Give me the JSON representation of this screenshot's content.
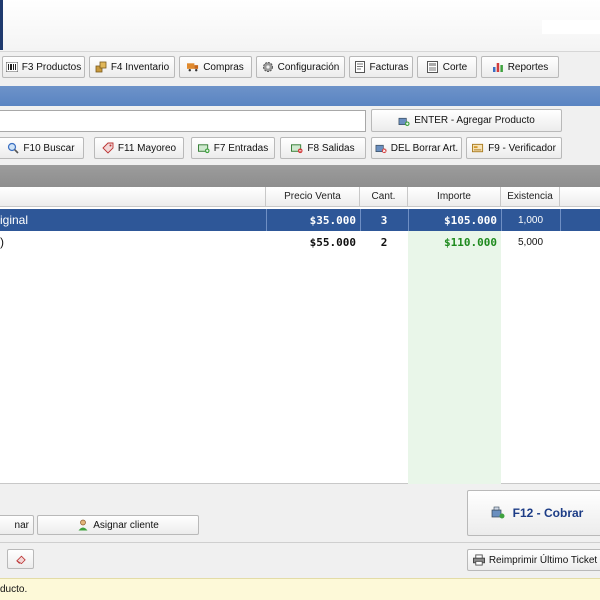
{
  "toolbar": {
    "buttons": [
      {
        "label": "F3 Productos",
        "icon": "barcode-icon"
      },
      {
        "label": "F4 Inventario",
        "icon": "boxes-icon"
      },
      {
        "label": "Compras",
        "icon": "truck-icon"
      },
      {
        "label": "Configuración",
        "icon": "gear-icon"
      },
      {
        "label": "Facturas",
        "icon": "invoice-icon"
      },
      {
        "label": "Corte",
        "icon": "register-icon"
      },
      {
        "label": "Reportes",
        "icon": "bar-chart-icon"
      }
    ]
  },
  "entry": {
    "input_value": "",
    "add_label": "ENTER - Agregar Producto"
  },
  "actions": {
    "buttons": [
      {
        "label": "F10 Buscar",
        "icon": "magnifier-icon"
      },
      {
        "label": "F11 Mayoreo",
        "icon": "tag-icon"
      },
      {
        "label": "F7 Entradas",
        "icon": "cash-in-icon"
      },
      {
        "label": "F8 Salidas",
        "icon": "cash-out-icon"
      },
      {
        "label": "DEL Borrar Art.",
        "icon": "delete-item-icon"
      },
      {
        "label": "F9 - Verificador",
        "icon": "price-check-icon"
      }
    ]
  },
  "table": {
    "headers": [
      "Precio Venta",
      "Cant.",
      "Importe",
      "Existencia"
    ],
    "rows": [
      {
        "description": "iginal",
        "price": "$35.000",
        "qty": "3",
        "amount": "$105.000",
        "stock": "1,000",
        "selected": true
      },
      {
        "description": ")",
        "price": "$55.000",
        "qty": "2",
        "amount": "$110.000",
        "stock": "5,000",
        "selected": false
      }
    ]
  },
  "bottom": {
    "partial_button_label": "nar",
    "assign_client_label": "Asignar cliente",
    "charge_label": "F12 - Cobrar",
    "reprint_label": "Reimprimir Último Ticket"
  },
  "status": {
    "message": "ducto."
  },
  "colors": {
    "selection_blue": "#2e5798",
    "amount_green": "#1e8a1e",
    "header_band_blue": "#5a84c2",
    "charge_text": "#1c3c86"
  }
}
